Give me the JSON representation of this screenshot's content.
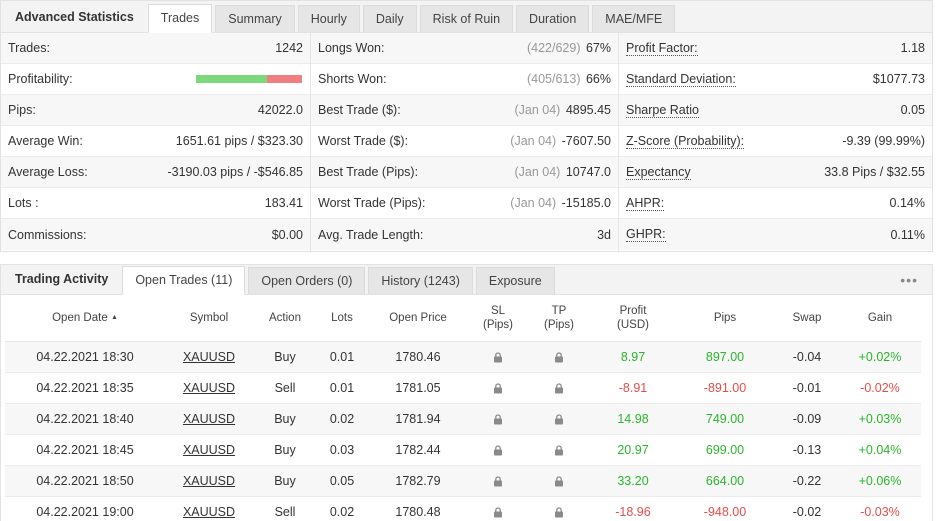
{
  "stats": {
    "title": "Advanced Statistics",
    "tabs": [
      "Trades",
      "Summary",
      "Hourly",
      "Daily",
      "Risk of Ruin",
      "Duration",
      "MAE/MFE"
    ],
    "profitability_win_fraction": 0.67,
    "col1": [
      {
        "label": "Trades:",
        "value": "1242"
      },
      {
        "label": "Profitability:",
        "value": ""
      },
      {
        "label": "Pips:",
        "value": "42022.0"
      },
      {
        "label": "Average Win:",
        "value": "1651.61 pips / $323.30"
      },
      {
        "label": "Average Loss:",
        "value": "-3190.03 pips / -$546.85"
      },
      {
        "label": "Lots :",
        "value": "183.41"
      },
      {
        "label": "Commissions:",
        "value": "$0.00"
      }
    ],
    "col2": [
      {
        "label": "Longs Won:",
        "sub": "(422/629)",
        "value": "67%"
      },
      {
        "label": "Shorts Won:",
        "sub": "(405/613)",
        "value": "66%"
      },
      {
        "label": "Best Trade ($):",
        "sub": "(Jan 04)",
        "value": "4895.45"
      },
      {
        "label": "Worst Trade ($):",
        "sub": "(Jan 04)",
        "value": "-7607.50"
      },
      {
        "label": "Best Trade (Pips):",
        "sub": "(Jan 04)",
        "value": "10747.0"
      },
      {
        "label": "Worst Trade (Pips):",
        "sub": "(Jan 04)",
        "value": "-15185.0"
      },
      {
        "label": "Avg. Trade Length:",
        "sub": "",
        "value": "3d"
      }
    ],
    "col3": [
      {
        "label": "Profit Factor:",
        "value": "1.18"
      },
      {
        "label": "Standard Deviation:",
        "value": "$1077.73"
      },
      {
        "label": "Sharpe Ratio",
        "value": "0.05"
      },
      {
        "label": "Z-Score (Probability):",
        "value": "-9.39 (99.99%)"
      },
      {
        "label": "Expectancy",
        "value": "33.8 Pips / $32.55"
      },
      {
        "label": "AHPR:",
        "value": "0.14%"
      },
      {
        "label": "GHPR:",
        "value": "0.11%"
      }
    ]
  },
  "activity": {
    "title": "Trading Activity",
    "tabs": [
      "Open Trades (11)",
      "Open Orders (0)",
      "History (1243)",
      "Exposure"
    ],
    "more_icon": "more-icon",
    "columns": {
      "open_date": "Open Date",
      "symbol": "Symbol",
      "action": "Action",
      "lots": "Lots",
      "open_price": "Open Price",
      "sl_1": "SL",
      "sl_2": "(Pips)",
      "tp_1": "TP",
      "tp_2": "(Pips)",
      "profit_1": "Profit",
      "profit_2": "(USD)",
      "pips": "Pips",
      "swap": "Swap",
      "gain": "Gain"
    },
    "rows": [
      {
        "date": "04.22.2021 18:30",
        "symbol": "XAUUSD",
        "action": "Buy",
        "lots": "0.01",
        "price": "1780.46",
        "profit": "8.97",
        "pips": "897.00",
        "swap": "-0.04",
        "gain": "+0.02%"
      },
      {
        "date": "04.22.2021 18:35",
        "symbol": "XAUUSD",
        "action": "Sell",
        "lots": "0.01",
        "price": "1781.05",
        "profit": "-8.91",
        "pips": "-891.00",
        "swap": "-0.01",
        "gain": "-0.02%"
      },
      {
        "date": "04.22.2021 18:40",
        "symbol": "XAUUSD",
        "action": "Buy",
        "lots": "0.02",
        "price": "1781.94",
        "profit": "14.98",
        "pips": "749.00",
        "swap": "-0.09",
        "gain": "+0.03%"
      },
      {
        "date": "04.22.2021 18:45",
        "symbol": "XAUUSD",
        "action": "Buy",
        "lots": "0.03",
        "price": "1782.44",
        "profit": "20.97",
        "pips": "699.00",
        "swap": "-0.13",
        "gain": "+0.04%"
      },
      {
        "date": "04.22.2021 18:50",
        "symbol": "XAUUSD",
        "action": "Buy",
        "lots": "0.05",
        "price": "1782.79",
        "profit": "33.20",
        "pips": "664.00",
        "swap": "-0.22",
        "gain": "+0.06%"
      },
      {
        "date": "04.22.2021 19:00",
        "symbol": "XAUUSD",
        "action": "Sell",
        "lots": "0.02",
        "price": "1780.48",
        "profit": "-18.96",
        "pips": "-948.00",
        "swap": "-0.02",
        "gain": "-0.03%"
      }
    ]
  },
  "colors": {
    "positive": "#2bb52b",
    "negative": "#e74c4c",
    "bar_green": "#7bd97b",
    "bar_red": "#f07f7f"
  }
}
